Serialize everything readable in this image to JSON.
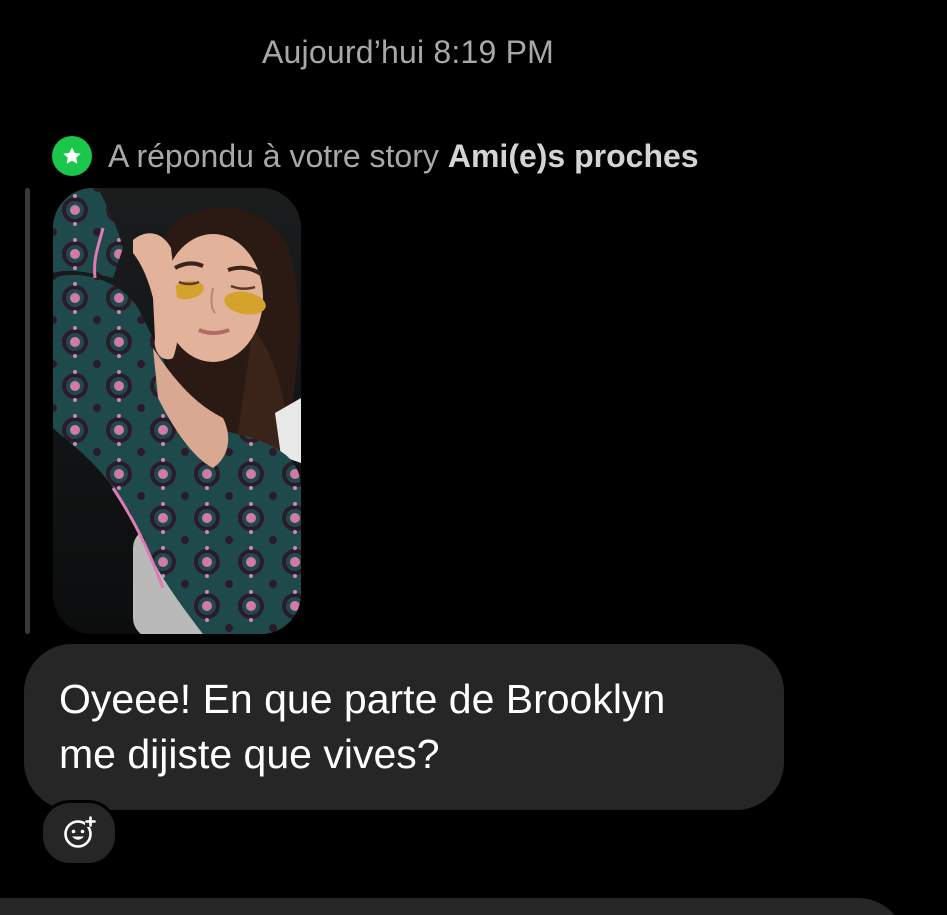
{
  "thread": {
    "timestamp": "Aujourd’hui 8:19 PM",
    "story_reply": {
      "badge_icon": "star-icon",
      "label": "A répondu à votre story",
      "audience": "Ami(e)s proches",
      "badge_color": "#1bc74b"
    },
    "story_thumbnail": {
      "alt": "story-photo"
    },
    "message": {
      "line1": "Oyeee! En que parte de Brooklyn",
      "line2": "me dijiste que vives?"
    },
    "react_button": {
      "icon": "add-reaction-icon"
    }
  },
  "colors": {
    "background": "#000000",
    "bubble": "#262626",
    "muted_text": "#a8a8a8",
    "close_friends_green": "#1bc74b"
  }
}
